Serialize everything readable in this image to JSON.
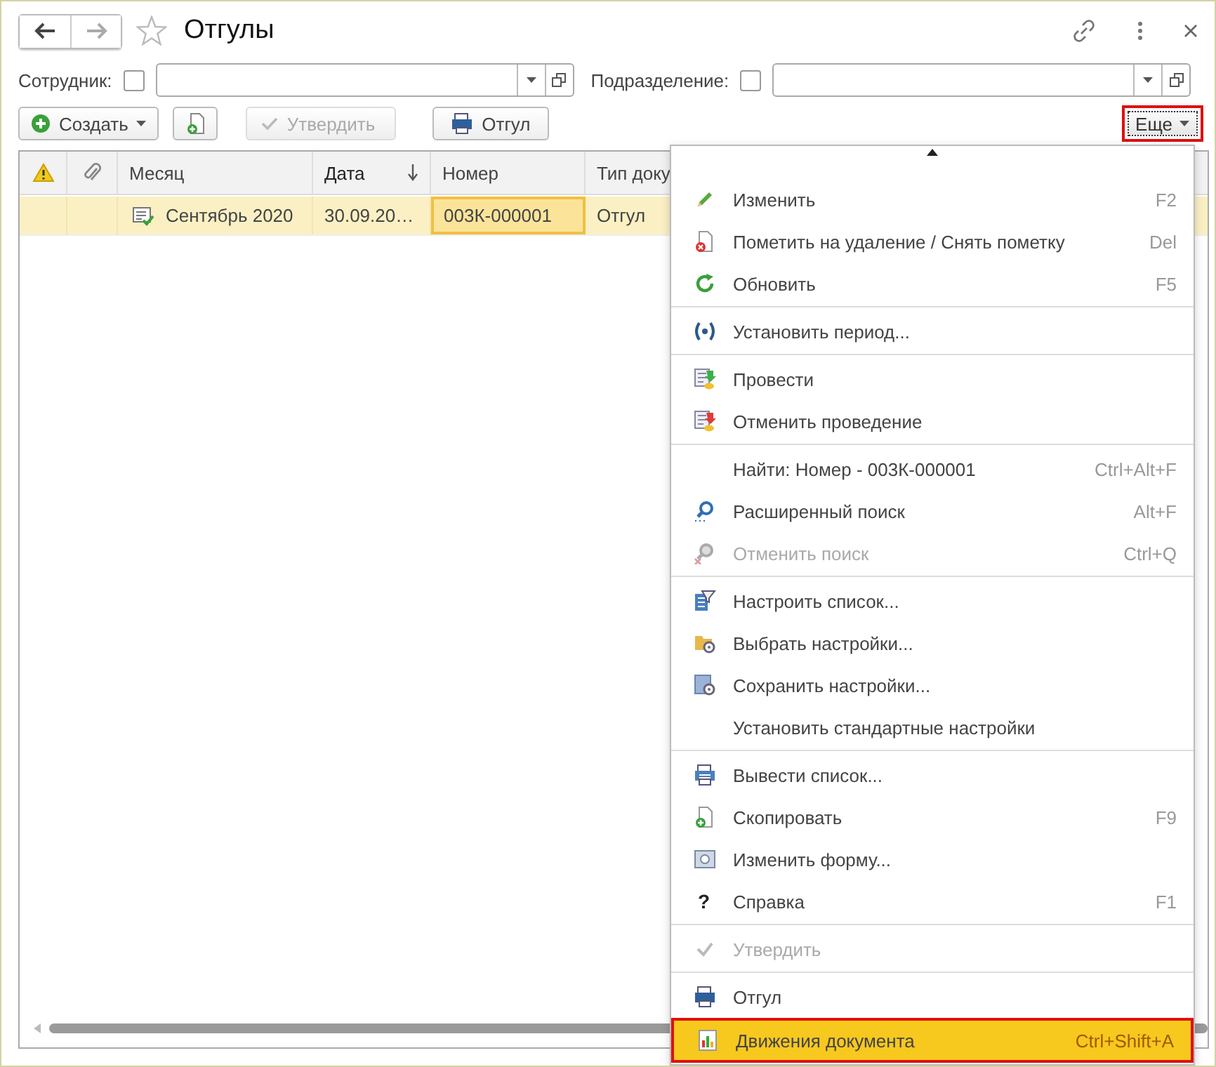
{
  "window": {
    "title": "Отгулы",
    "nav_forward_disabled": true
  },
  "filters": [
    {
      "label": "Сотрудник:",
      "checked": false
    },
    {
      "label": "Подразделение:",
      "checked": false
    }
  ],
  "toolbar": {
    "buttons": [
      {
        "kind": "dropdown",
        "label": "Создать",
        "disabled": false
      },
      {
        "kind": "copy",
        "disabled": false
      },
      {
        "kind": "check",
        "label": "Утвердить",
        "disabled": true
      },
      {
        "kind": "print",
        "label": "Отгул",
        "disabled": false
      }
    ],
    "more": {
      "label": "Еще",
      "annotated": true
    }
  },
  "table": {
    "columns": [
      {
        "label": "Месяц",
        "sorted": false
      },
      {
        "label": "Дата",
        "sorted": true
      },
      {
        "label": "Номер",
        "sorted": false
      },
      {
        "label": "Тип доку",
        "sorted": false
      }
    ],
    "rows": [
      {
        "selected": true,
        "posted": true,
        "cells": [
          {
            "text": "Сентябрь 2020",
            "focused": false
          },
          {
            "text": "30.09.20…",
            "focused": false
          },
          {
            "text": "003К-000001",
            "focused": true
          },
          {
            "text": "Отгул",
            "focused": false
          }
        ]
      }
    ]
  },
  "menu": {
    "groups": [
      [
        {
          "label": "Изменить",
          "shortcut": "F2",
          "disabled": false,
          "selected": false,
          "annotated": false
        },
        {
          "label": "Пометить на удаление / Снять пометку",
          "shortcut": "Del",
          "disabled": false,
          "selected": false,
          "annotated": false
        },
        {
          "label": "Обновить",
          "shortcut": "F5",
          "disabled": false,
          "selected": false,
          "annotated": false
        }
      ],
      [
        {
          "label": "Установить период...",
          "disabled": false,
          "selected": false,
          "annotated": false
        }
      ],
      [
        {
          "label": "Провести",
          "disabled": false,
          "selected": false,
          "annotated": false
        },
        {
          "label": "Отменить проведение",
          "disabled": false,
          "selected": false,
          "annotated": false
        }
      ],
      [
        {
          "label": "Найти: Номер - 003К-000001",
          "shortcut": "Ctrl+Alt+F",
          "disabled": false,
          "selected": false,
          "annotated": false
        },
        {
          "label": "Расширенный поиск",
          "shortcut": "Alt+F",
          "disabled": false,
          "selected": false,
          "annotated": false
        },
        {
          "label": "Отменить поиск",
          "shortcut": "Ctrl+Q",
          "disabled": true,
          "selected": false,
          "annotated": false
        }
      ],
      [
        {
          "label": "Настроить список...",
          "disabled": false,
          "selected": false,
          "annotated": false
        },
        {
          "label": "Выбрать настройки...",
          "disabled": false,
          "selected": false,
          "annotated": false
        },
        {
          "label": "Сохранить настройки...",
          "disabled": false,
          "selected": false,
          "annotated": false
        },
        {
          "label": "Установить стандартные настройки",
          "disabled": false,
          "selected": false,
          "annotated": false
        }
      ],
      [
        {
          "label": "Вывести список...",
          "disabled": false,
          "selected": false,
          "annotated": false
        },
        {
          "label": "Скопировать",
          "shortcut": "F9",
          "disabled": false,
          "selected": false,
          "annotated": false
        },
        {
          "label": "Изменить форму...",
          "disabled": false,
          "selected": false,
          "annotated": false
        },
        {
          "glyph": "?",
          "label": "Справка",
          "shortcut": "F1",
          "disabled": false,
          "selected": false,
          "annotated": false
        }
      ],
      [
        {
          "label": "Утвердить",
          "disabled": true,
          "selected": false,
          "annotated": false
        }
      ],
      [
        {
          "label": "Отгул",
          "disabled": false,
          "selected": false,
          "annotated": false
        },
        {
          "label": "Движения документа",
          "shortcut": "Ctrl+Shift+A",
          "disabled": false,
          "selected": true,
          "annotated": true
        }
      ]
    ]
  }
}
